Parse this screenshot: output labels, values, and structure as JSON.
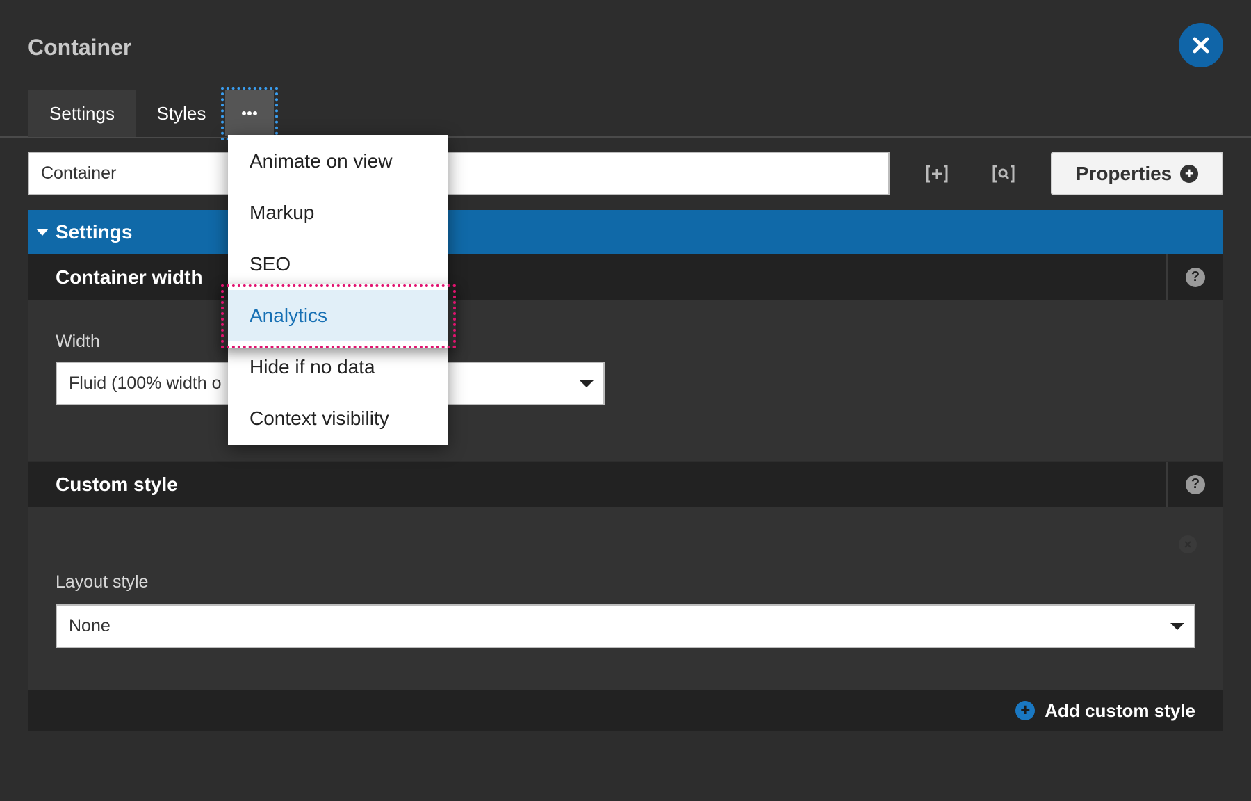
{
  "header": {
    "title": "Container"
  },
  "tabs": [
    {
      "label": "Settings"
    },
    {
      "label": "Styles"
    },
    {
      "label": "···"
    }
  ],
  "name_input": {
    "value": "Container"
  },
  "toolbar": {
    "properties_label": "Properties"
  },
  "settings_bar": {
    "label": "Settings"
  },
  "container_width": {
    "heading": "Container width",
    "width_label": "Width",
    "width_value": "Fluid (100% width o"
  },
  "custom_style": {
    "heading": "Custom style",
    "layout_label": "Layout style",
    "layout_value": "None",
    "add_label": "Add custom style"
  },
  "menu": {
    "items": [
      {
        "label": "Animate on view"
      },
      {
        "label": "Markup"
      },
      {
        "label": "SEO"
      },
      {
        "label": "Analytics",
        "active": true
      },
      {
        "label": "Hide if no data"
      },
      {
        "label": "Context visibility"
      }
    ]
  },
  "colors": {
    "accent": "#1069a8",
    "background": "#2d2d2d",
    "focus_blue": "#3a9ef0",
    "focus_pink": "#e0126e"
  }
}
